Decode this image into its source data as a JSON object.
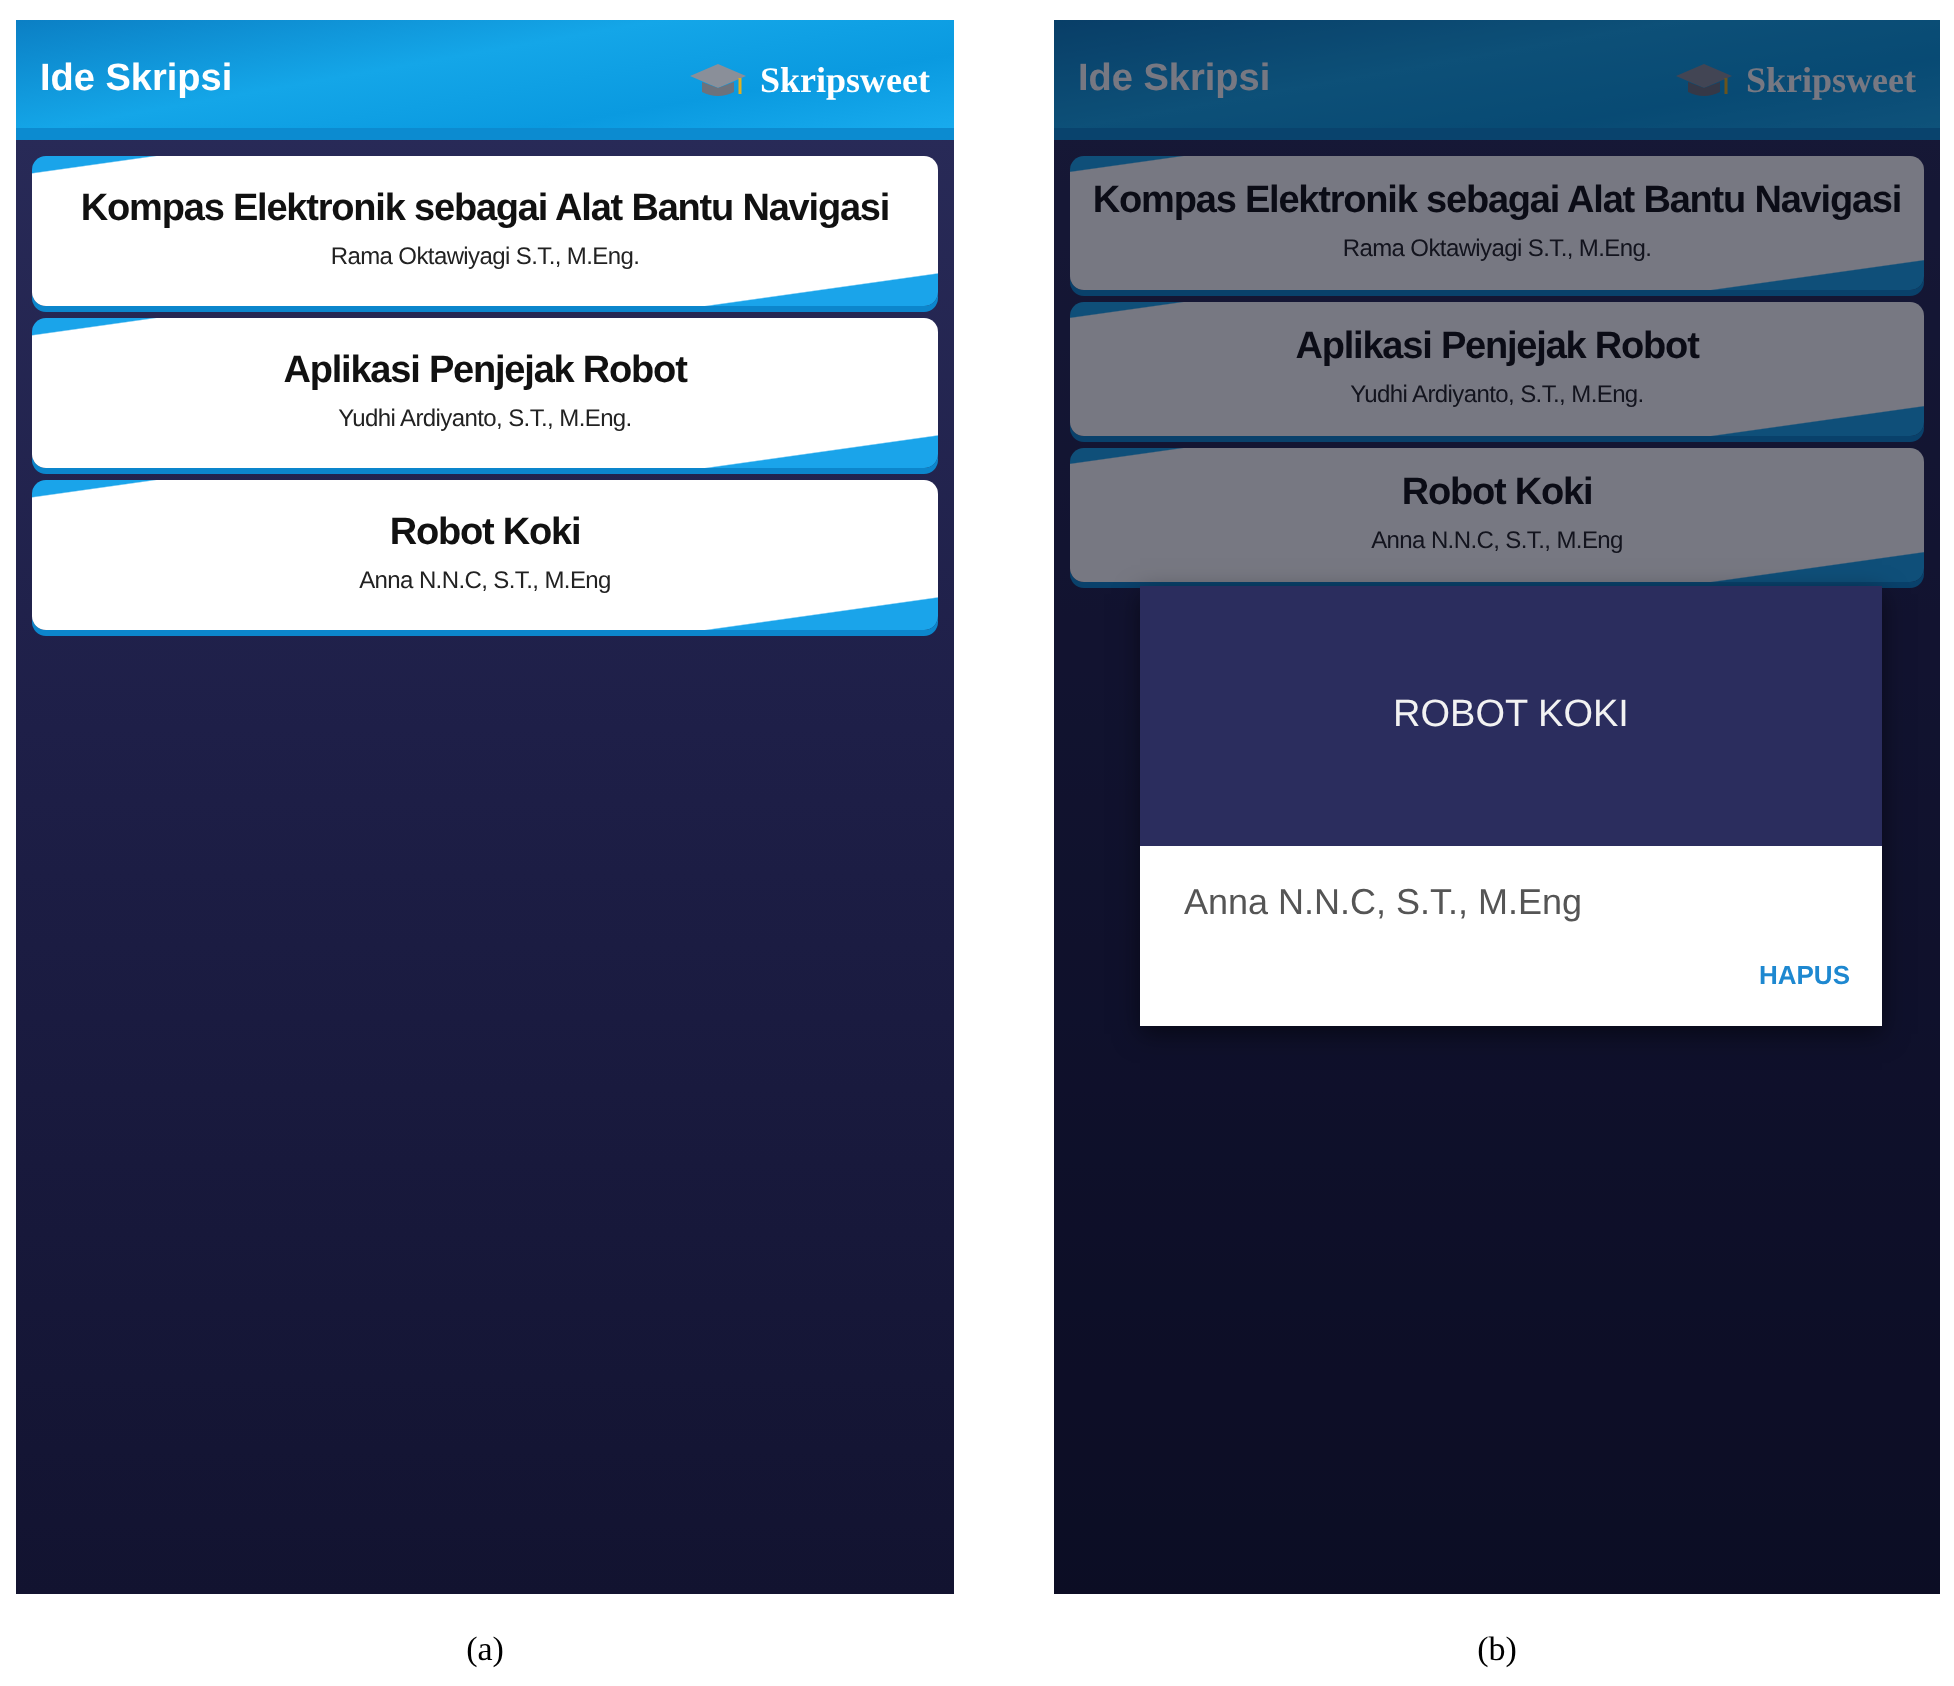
{
  "panels": [
    {
      "caption": "(a)",
      "app_bar": {
        "title": "Ide Skripsi",
        "brand": "Skripsweet"
      },
      "items": [
        {
          "title": "Kompas Elektronik sebagai Alat Bantu Navigasi",
          "supervisor": "Rama Oktawiyagi S.T., M.Eng."
        },
        {
          "title": "Aplikasi Penjejak Robot",
          "supervisor": "Yudhi Ardiyanto, S.T., M.Eng."
        },
        {
          "title": "Robot Koki",
          "supervisor": "Anna N.N.C, S.T., M.Eng"
        }
      ]
    },
    {
      "caption": "(b)",
      "app_bar": {
        "title": "Ide Skripsi",
        "brand": "Skripsweet"
      },
      "items": [
        {
          "title": "Kompas Elektronik sebagai Alat Bantu Navigasi",
          "supervisor": "Rama Oktawiyagi S.T., M.Eng."
        },
        {
          "title": "Aplikasi Penjejak Robot",
          "supervisor": "Yudhi Ardiyanto, S.T., M.Eng."
        },
        {
          "title": "Robot Koki",
          "supervisor": "Anna N.N.C, S.T., M.Eng"
        }
      ],
      "dialog": {
        "title": "ROBOT KOKI",
        "message": "Anna N.N.C, S.T., M.Eng",
        "button": "HAPUS"
      }
    }
  ]
}
